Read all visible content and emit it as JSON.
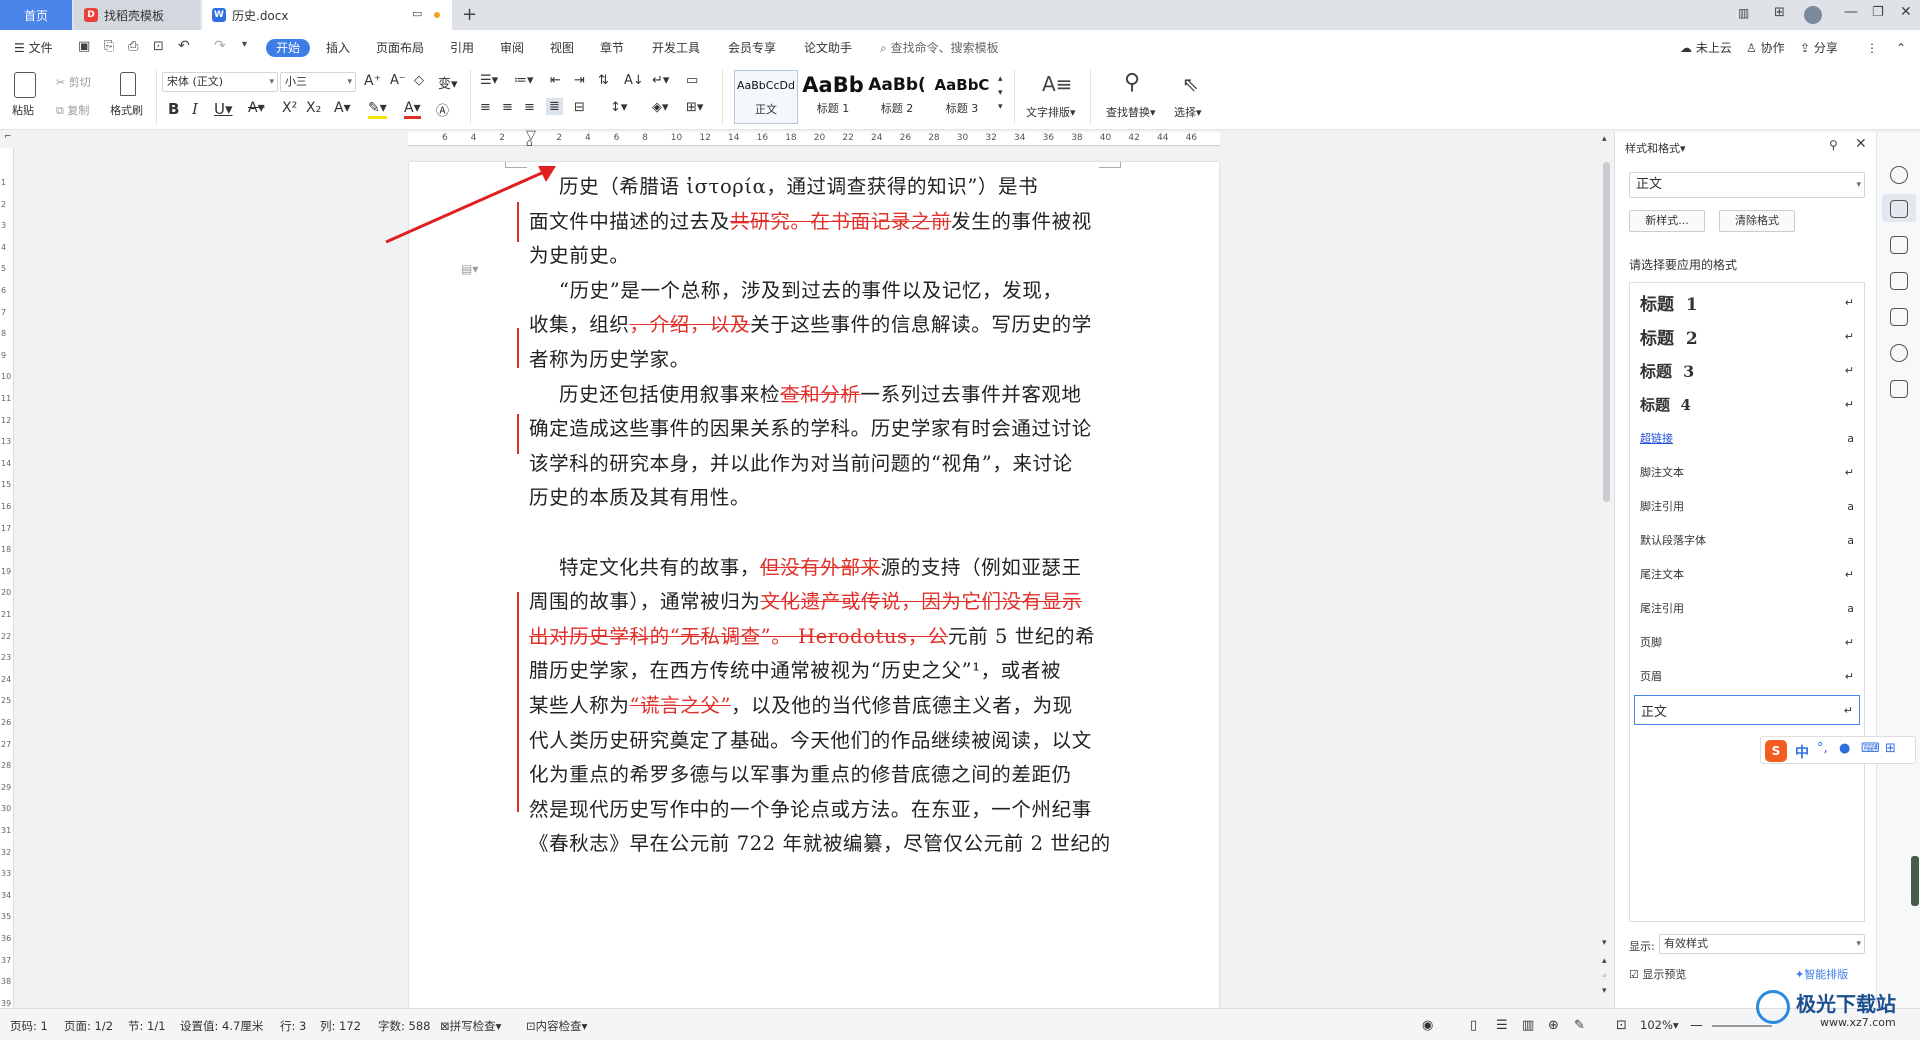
{
  "tabs": {
    "home": "首页",
    "template": "找稻壳模板",
    "document": "历史.docx"
  },
  "menu": {
    "file": "文件",
    "start": "开始",
    "insert": "插入",
    "layout": "页面布局",
    "reference": "引用",
    "review": "审阅",
    "view": "视图",
    "chapter": "章节",
    "devtools": "开发工具",
    "member": "会员专享",
    "thesis": "论文助手",
    "search_placeholder": "查找命令、搜索模板",
    "cloud": "未上云",
    "collab": "协作",
    "share": "分享"
  },
  "ribbon": {
    "paste": "粘贴",
    "cut": "剪切",
    "copy": "复制",
    "format_painter": "格式刷",
    "font_name": "宋体 (正文)",
    "font_size": "小三",
    "styles": [
      {
        "sample": "AaBbCcDd",
        "name": "正文"
      },
      {
        "sample": "AaBb",
        "name": "标题 1"
      },
      {
        "sample": "AaBb(",
        "name": "标题 2"
      },
      {
        "sample": "AaBbC",
        "name": "标题 3"
      }
    ],
    "text_layout": "文字排版",
    "find_replace": "查找替换",
    "select": "选择"
  },
  "ruler_ticks": [
    "6",
    "4",
    "2",
    "",
    "2",
    "4",
    "6",
    "8",
    "10",
    "12",
    "14",
    "16",
    "18",
    "20",
    "22",
    "24",
    "26",
    "28",
    "30",
    "32",
    "34",
    "36",
    "38",
    "40",
    "42",
    "44",
    "46"
  ],
  "vruler_ticks": [
    "1",
    "2",
    "3",
    "4",
    "5",
    "6",
    "7",
    "8",
    "9",
    "10",
    "11",
    "12",
    "13",
    "14",
    "15",
    "16",
    "17",
    "18",
    "19",
    "20",
    "21",
    "22",
    "23",
    "24",
    "25",
    "26",
    "27",
    "28",
    "29",
    "30",
    "31",
    "32",
    "33",
    "34",
    "35",
    "36",
    "37",
    "38",
    "39"
  ],
  "document": {
    "lines": [
      [
        {
          "t": "历史（希腊语 ἱστορία，通过调查获得的知识”）是书",
          "d": false
        }
      ],
      [
        {
          "t": "面文件中描述的过去及",
          "d": false
        },
        {
          "t": "共研究。在书面记录之前",
          "d": true
        },
        {
          "t": "发生的事件被视",
          "d": false
        }
      ],
      [
        {
          "t": "为史前史。",
          "d": false
        }
      ],
      [
        {
          "t": "“历史”是一个总称，涉及到过去的事件以及记忆，发现，",
          "d": false
        }
      ],
      [
        {
          "t": "收集，组织",
          "d": false
        },
        {
          "t": "，介绍，以及",
          "d": true
        },
        {
          "t": "关于这些事件的信息解读。写历史的学",
          "d": false
        }
      ],
      [
        {
          "t": "者称为历史学家。",
          "d": false
        }
      ],
      [
        {
          "t": "历史还包括使用叙事来检",
          "d": false
        },
        {
          "t": "查和分析",
          "d": true
        },
        {
          "t": "一系列过去事件并客观地",
          "d": false
        }
      ],
      [
        {
          "t": "确定造成这些事件的因果关系的学科。历史学家有时会通过讨论",
          "d": false
        }
      ],
      [
        {
          "t": "该学科的研究本身，并以此作为对当前问题的“视角”，来讨论",
          "d": false
        }
      ],
      [
        {
          "t": "历史的本质及其有用性。",
          "d": false
        }
      ],
      [
        {
          "t": "",
          "d": false
        }
      ],
      [
        {
          "t": "特定文化共有的故事，",
          "d": false
        },
        {
          "t": "但没有外部来",
          "d": true
        },
        {
          "t": "源的支持（例如亚瑟王",
          "d": false
        }
      ],
      [
        {
          "t": "周围的故事），通常被归为",
          "d": false
        },
        {
          "t": "文化遗产或传说，因为它们没有显示",
          "d": true
        }
      ],
      [
        {
          "t": "出对历史学科的“无私调查”。 Herodotus，公",
          "d": true
        },
        {
          "t": "元前 5 世纪的希",
          "d": false
        }
      ],
      [
        {
          "t": "腊历史学家，在西方传统中通常被视为“历史之父”¹，或者被",
          "d": false
        }
      ],
      [
        {
          "t": "某些人称为",
          "d": false
        },
        {
          "t": "“谎言之父”",
          "d": true
        },
        {
          "t": "，以及他的当代修昔底德主义者，为现",
          "d": false
        }
      ],
      [
        {
          "t": "代人类历史研究奠定了基础。今天他们的作品继续被阅读，以文",
          "d": false
        }
      ],
      [
        {
          "t": "化为重点的希罗多德与以军事为重点的修昔底德之间的差距仍",
          "d": false
        }
      ],
      [
        {
          "t": "然是现代历史写作中的一个争论点或方法。在东亚，一个州纪事",
          "d": false
        }
      ],
      [
        {
          "t": "《春秋志》早在公元前 722 年就被编纂，尽管仅公元前 2 世纪的",
          "d": false
        }
      ]
    ]
  },
  "pane": {
    "title": "样式和格式",
    "current_style": "正文",
    "new_style": "新样式...",
    "clear_format": "清除格式",
    "prompt": "请选择要应用的格式",
    "styles": [
      {
        "name": "标题  1",
        "mark": "↵"
      },
      {
        "name": "标题  2",
        "mark": "↵"
      },
      {
        "name": "标题  3",
        "mark": "↵"
      },
      {
        "name": "标题  4",
        "mark": "↵"
      },
      {
        "name": "超链接",
        "mark": "a"
      },
      {
        "name": "脚注文本",
        "mark": "↵"
      },
      {
        "name": "脚注引用",
        "mark": "a"
      },
      {
        "name": "默认段落字体",
        "mark": "a"
      },
      {
        "name": "尾注文本",
        "mark": "↵"
      },
      {
        "name": "尾注引用",
        "mark": "a"
      },
      {
        "name": "页脚",
        "mark": "↵"
      },
      {
        "name": "页眉",
        "mark": "↵"
      },
      {
        "name": "正文",
        "mark": "↵"
      }
    ],
    "show_label": "显示:",
    "show_value": "有效样式",
    "preview": "显示预览",
    "smart_layout": "智能排版"
  },
  "ime": {
    "lang": "中"
  },
  "status": {
    "page": "页码: 1",
    "pages": "页面: 1/2",
    "section": "节: 1/1",
    "setting": "设置值: 4.7厘米",
    "row": "行: 3",
    "col": "列: 172",
    "words": "字数: 588",
    "spell": "拼写检查",
    "content_check": "内容检查",
    "zoom": "102%"
  },
  "watermark": {
    "text": "极光下载站",
    "url": "www.xz7.com"
  },
  "colors": {
    "accent": "#3f7de6",
    "revision": "#e0302a",
    "arrow": "#e02020"
  }
}
